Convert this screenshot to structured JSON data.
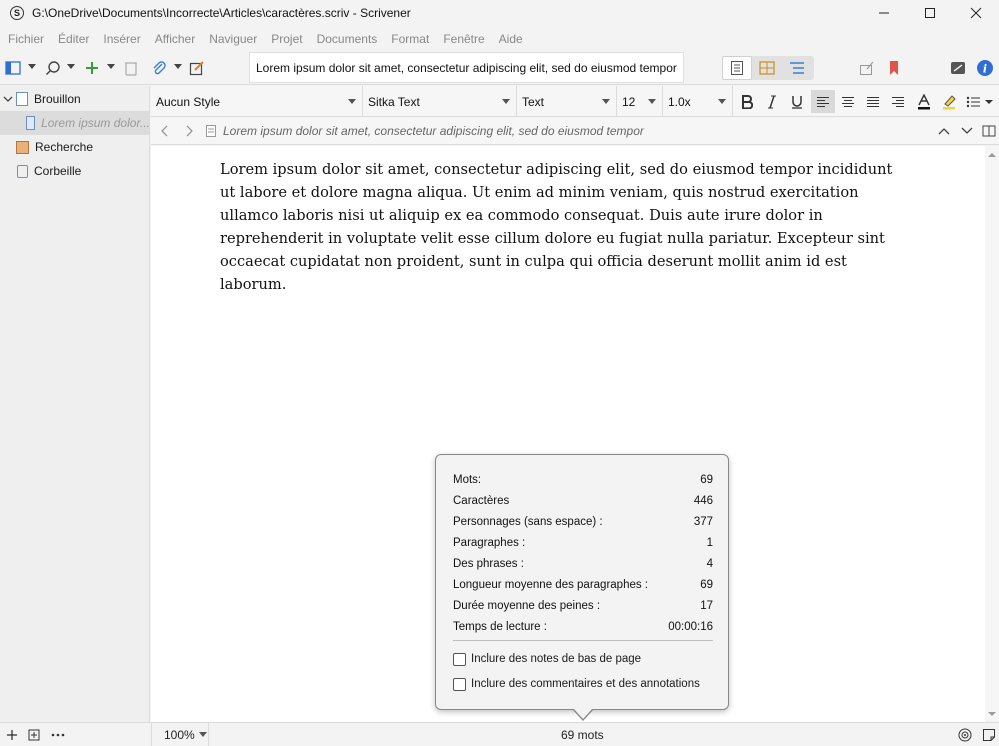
{
  "window": {
    "title": "G:\\OneDrive\\Documents\\Incorrecte\\Articles\\caractères.scriv - Scrivener",
    "app_icon_glyph": "S"
  },
  "menu": [
    "Fichier",
    "Éditer",
    "Insérer",
    "Afficher",
    "Naviguer",
    "Projet",
    "Documents",
    "Format",
    "Fenêtre",
    "Aide"
  ],
  "toolbar": {
    "document_title": "Lorem ipsum dolor sit amet, consectetur adipiscing elit, sed do eiusmod tempor"
  },
  "binder": {
    "items": [
      {
        "label": "Brouillon",
        "icon": "draft-folder-icon"
      },
      {
        "label": "Lorem ipsum dolor...",
        "icon": "document-icon",
        "selected": true
      },
      {
        "label": "Recherche",
        "icon": "research-folder-icon"
      },
      {
        "label": "Corbeille",
        "icon": "trash-icon"
      }
    ]
  },
  "format_bar": {
    "style": "Aucun Style",
    "font_family": "Sitka Text",
    "font_face": "Text",
    "font_size": "12",
    "line_spacing": "1.0x"
  },
  "header": {
    "title": "Lorem ipsum dolor sit amet, consectetur adipiscing elit, sed do eiusmod tempor"
  },
  "editor": {
    "text": "Lorem ipsum dolor sit amet, consectetur adipiscing elit, sed do eiusmod tempor incididunt ut labore et dolore magna aliqua. Ut enim ad minim veniam, quis nostrud exercitation ullamco laboris nisi ut aliquip ex ea commodo consequat. Duis aute irure dolor in reprehenderit in voluptate velit esse cillum dolore eu fugiat nulla pariatur. Excepteur sint occaecat cupidatat non proident, sunt in culpa qui officia deserunt mollit anim id est laborum."
  },
  "stats": {
    "rows": [
      {
        "label": "Mots:",
        "value": "69"
      },
      {
        "label": "Caractères",
        "value": "446"
      },
      {
        "label": "Personnages (sans espace) :",
        "value": "377"
      },
      {
        "label": "Paragraphes :",
        "value": "1"
      },
      {
        "label": "Des phrases :",
        "value": "4"
      },
      {
        "label": "Longueur moyenne des paragraphes :",
        "value": "69"
      },
      {
        "label": "Durée moyenne des peines :",
        "value": "17"
      },
      {
        "label": "Temps de lecture :",
        "value": "00:00:16"
      }
    ],
    "checkbox_footnotes": "Inclure des notes de bas de page",
    "checkbox_comments": "Inclure des commentaires et des annotations"
  },
  "footer": {
    "zoom": "100%",
    "word_count": "69 mots"
  },
  "colors": {
    "accent_blue": "#3b7dd8",
    "bookmark_red": "#e0534a",
    "info_blue": "#2f6fd1"
  }
}
